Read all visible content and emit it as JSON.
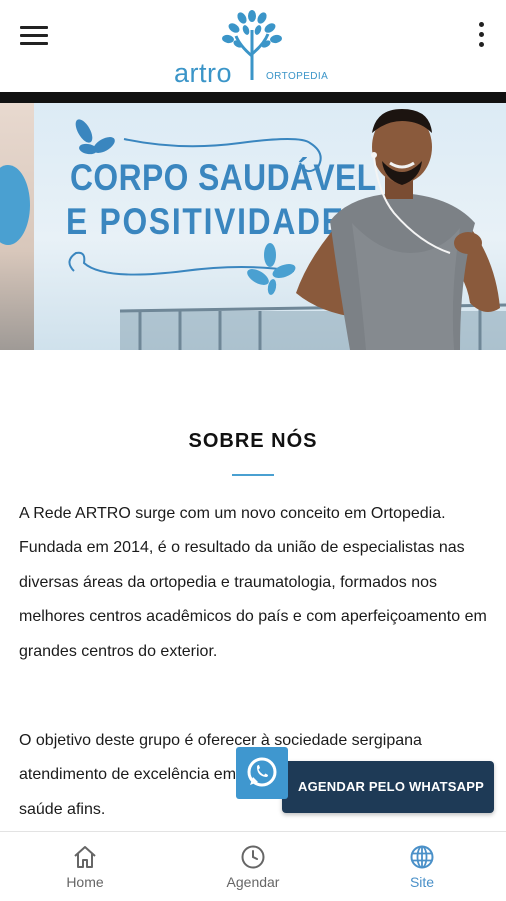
{
  "header": {
    "logo_word": "artro",
    "logo_sub": "ORTOPEDIA",
    "menu_icon": "hamburger-menu-icon",
    "more_icon": "more-vertical-icon"
  },
  "banner": {
    "line1": "CORPO SAUDÁVEL",
    "line2": "E POSITIVIDADE."
  },
  "about": {
    "title": "SOBRE NÓS",
    "paragraph1": "A Rede ARTRO surge com um novo conceito em Ortopedia. Fundada em 2014, é o resultado da união de especialistas nas diversas áreas da ortopedia e traumatologia, formados nos melhores centros acadêmicos do país e com aperfeiçoamento em grandes centros do exterior.",
    "paragraph2": "O objetivo deste grupo é oferecer à sociedade sergipana atendimento de excelência em ortopedia, trauma e áreas da saúde afins."
  },
  "whatsapp": {
    "label": "AGENDAR PELO WHATSAPP",
    "icon": "whatsapp-icon"
  },
  "bottom_nav": [
    {
      "label": "Home",
      "icon": "home-icon",
      "active": false
    },
    {
      "label": "Agendar",
      "icon": "clock-icon",
      "active": false
    },
    {
      "label": "Site",
      "icon": "globe-icon",
      "active": true
    }
  ],
  "colors": {
    "brand_blue": "#3b95c8",
    "whatsapp_bar": "#1e3a56",
    "active_nav": "#4a90c8"
  }
}
